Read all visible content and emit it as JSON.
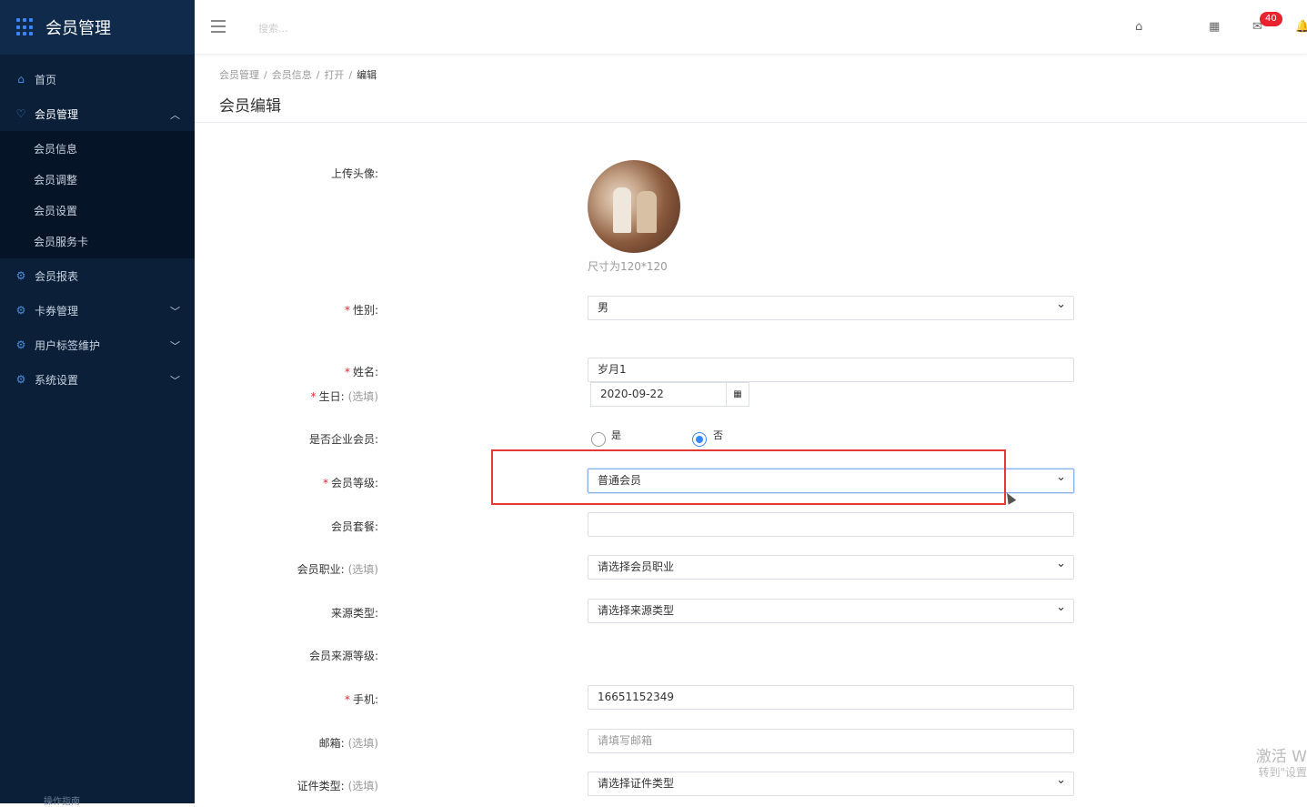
{
  "app": {
    "title": "会员管理"
  },
  "sidebar": {
    "items": [
      {
        "label": "首页",
        "icon": "home-icon"
      },
      {
        "label": "会员管理",
        "icon": "heart-icon"
      },
      {
        "label": "会员报表",
        "icon": "gear-icon"
      },
      {
        "label": "卡券管理",
        "icon": "gear-icon"
      },
      {
        "label": "用户标签维护",
        "icon": "gear-icon"
      },
      {
        "label": "系统设置",
        "icon": "gear-icon"
      }
    ],
    "sub_items": [
      "会员信息",
      "会员调整",
      "会员设置",
      "会员服务卡"
    ],
    "bottom_text": "操作指南"
  },
  "header": {
    "search_placeholder": "搜索...",
    "badge_count": "40"
  },
  "breadcrumb": [
    "会员管理",
    "会员信息",
    "打开",
    "编辑"
  ],
  "page_title": "会员编辑",
  "form": {
    "avatar_label": "上传头像:",
    "avatar_note": "尺寸为120*120",
    "gender_label": "性别:",
    "gender_value": "男",
    "name_label": "姓名:",
    "name_value": "岁月1",
    "birthday_label": "生日:",
    "optional": "(选填)",
    "birthday_value": "2020-09-22",
    "enterprise_label": "是否企业会员:",
    "yes": "是",
    "no": "否",
    "level_label": "会员等级:",
    "level_value": "普通会员",
    "package_label": "会员套餐:",
    "package_value": "",
    "job_label": "会员职业:",
    "job_placeholder": "请选择会员职业",
    "source_type_label": "来源类型:",
    "source_type_placeholder": "请选择来源类型",
    "source_level_label": "会员来源等级:",
    "phone_label": "手机:",
    "phone_value": "16651152349",
    "email_label": "邮箱:",
    "email_placeholder": "请填写邮箱",
    "id_type_label": "证件类型:",
    "id_type_placeholder": "请选择证件类型"
  },
  "watermark": {
    "line1": "激活 W",
    "line2": "转到\"设置"
  }
}
